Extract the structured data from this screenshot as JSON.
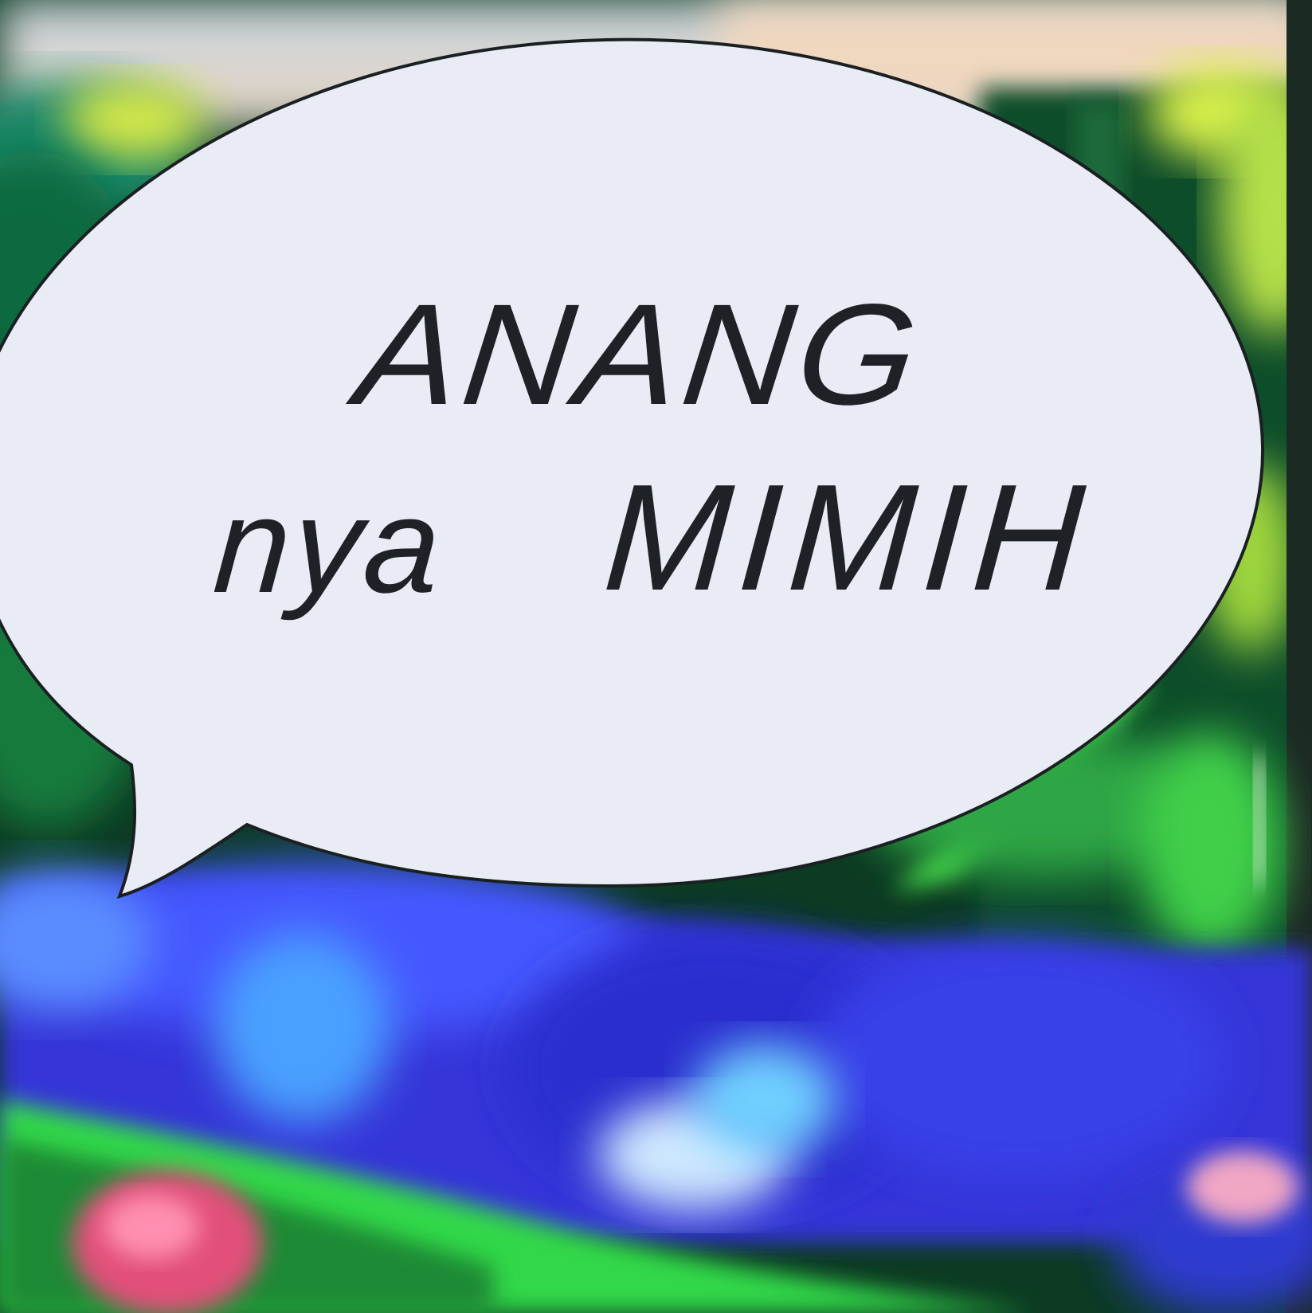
{
  "bubble": {
    "line1": "ANANG",
    "line2_left": "nya",
    "line2_right": "MIMIH"
  },
  "colors": {
    "bubble_fill": "#e9ecf5",
    "bubble_outline": "#1a1f22",
    "text": "#1e2226",
    "foliage_green": "#1d7a3a",
    "bright_green": "#5cff4a",
    "water_blue": "#3b3cff",
    "accent_yellow": "#d8f04a",
    "flower_pink": "#e2507a"
  },
  "icons": {
    "speech_bubble": "speech-bubble-icon"
  }
}
